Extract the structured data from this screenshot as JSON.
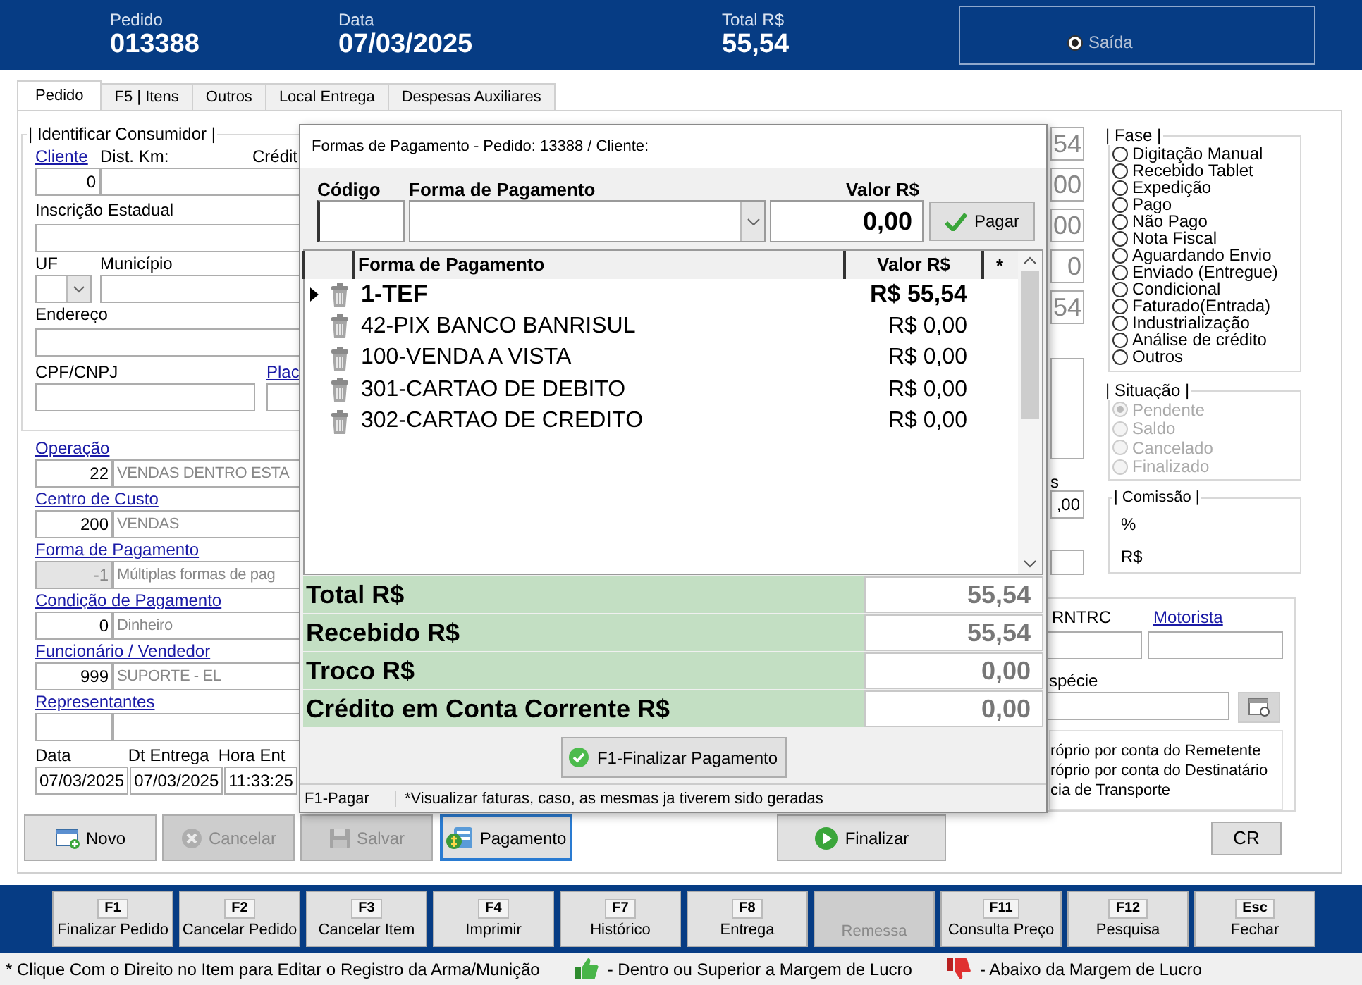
{
  "header": {
    "fields": [
      {
        "label": "Pedido",
        "value": "013388"
      },
      {
        "label": "Data",
        "value": "07/03/2025"
      },
      {
        "label": "Total R$",
        "value": "55,54"
      }
    ],
    "radio": {
      "label": "Saída",
      "selected": true
    }
  },
  "tabs": [
    {
      "label": "Pedido",
      "selected": true
    },
    {
      "label": "F5 | Itens",
      "selected": false
    },
    {
      "label": "Outros",
      "selected": false
    },
    {
      "label": "Local Entrega",
      "selected": false
    },
    {
      "label": "Despesas Auxiliares",
      "selected": false
    }
  ],
  "consumer": {
    "title": "| Identificar Consumidor |",
    "client_link": "Cliente",
    "distance_label": "Dist. Km:",
    "credit_label": "Crédit",
    "client_code": "0",
    "state_registration_label": "Inscrição Estadual",
    "uf_label": "UF",
    "city_label": "Município",
    "address_label": "Endereço",
    "document_label": "CPF/CNPJ",
    "plate_link": "Plac"
  },
  "lookups": [
    {
      "label": "Operação",
      "code": "22",
      "description": "VENDAS DENTRO ESTA",
      "disabled": false
    },
    {
      "label": "Centro de Custo",
      "code": "200",
      "description": "VENDAS",
      "disabled": false
    },
    {
      "label": "Forma de Pagamento",
      "code": "-1",
      "description": "Múltiplas formas de pag",
      "disabled": true
    },
    {
      "label": "Condição de Pagamento",
      "code": "0",
      "description": "Dinheiro",
      "disabled": false
    },
    {
      "label": "Funcionário / Vendedor",
      "code": "999",
      "description": "SUPORTE - EL",
      "disabled": false
    },
    {
      "label": "Representantes",
      "disabled": false
    }
  ],
  "dates": [
    {
      "label": "Data",
      "value": "07/03/2025"
    },
    {
      "label": "Dt Entrega",
      "value": "07/03/2025"
    },
    {
      "label": "Hora Ent",
      "value": "11:33:25"
    }
  ],
  "totals_strip": {
    "values": [
      "54",
      "00",
      "00",
      "0",
      "54"
    ],
    "label": "s",
    "value": ",00"
  },
  "phase": {
    "title": "| Fase |",
    "options": [
      {
        "label": "Digitação Manual",
        "selected": false
      },
      {
        "label": "Recebido Tablet",
        "selected": false
      },
      {
        "label": "Expedição",
        "selected": false
      },
      {
        "label": "Pago",
        "selected": false
      },
      {
        "label": "Não Pago",
        "selected": false
      },
      {
        "label": "Nota Fiscal",
        "selected": false
      },
      {
        "label": "Aguardando Envio",
        "selected": false
      },
      {
        "label": "Enviado (Entregue)",
        "selected": false
      },
      {
        "label": "Condicional",
        "selected": false
      },
      {
        "label": "Faturado(Entrada)",
        "selected": false
      },
      {
        "label": "Industrialização",
        "selected": false
      },
      {
        "label": "Análise de crédito",
        "selected": false
      },
      {
        "label": "Outros",
        "selected": false
      }
    ]
  },
  "situation": {
    "title": "| Situação |",
    "options": [
      {
        "label": "Pendente",
        "selected": true,
        "disabled": true
      },
      {
        "label": "Saldo",
        "selected": false,
        "disabled": true
      },
      {
        "label": "Cancelado",
        "selected": false,
        "disabled": true
      },
      {
        "label": "Finalizado",
        "selected": false,
        "disabled": true
      }
    ]
  },
  "commission": {
    "title": "| Comissão |",
    "percent_label": "%",
    "value_label": "R$"
  },
  "transport": {
    "rntrc_label": "RNTRC",
    "driver_link": "Motorista",
    "species_label": "spécie",
    "freight_options": [
      "róprio por conta do Remetente",
      "róprio por conta do Destinatário",
      "cia de Transporte"
    ]
  },
  "actions": [
    {
      "label": "Novo",
      "kind": "new",
      "disabled": false,
      "focused": false
    },
    {
      "label": "Cancelar",
      "kind": "cancel",
      "disabled": true,
      "focused": false
    },
    {
      "label": "Salvar",
      "kind": "save",
      "disabled": true,
      "focused": false
    },
    {
      "label": "Pagamento",
      "kind": "payment",
      "disabled": false,
      "focused": true
    },
    {
      "label": "Finalizar",
      "kind": "finish",
      "disabled": false,
      "focused": false
    },
    {
      "label": "CR",
      "kind": "plain",
      "disabled": false,
      "focused": false
    }
  ],
  "dialog": {
    "title": "Formas de Pagamento - Pedido: 13388 / Cliente:",
    "code_label": "Código",
    "method_label": "Forma de Pagamento",
    "amount_label": "Valor R$",
    "amount_value": "0,00",
    "pay_button": "Pagar",
    "columns": [
      "Forma de Pagamento",
      "Valor R$",
      "*"
    ],
    "rows": [
      {
        "method": "1-TEF",
        "amount": "R$ 55,54",
        "selected": true
      },
      {
        "method": "42-PIX BANCO BANRISUL",
        "amount": "R$ 0,00",
        "selected": false
      },
      {
        "method": "100-VENDA A VISTA",
        "amount": "R$ 0,00",
        "selected": false
      },
      {
        "method": "301-CARTAO DE DEBITO",
        "amount": "R$ 0,00",
        "selected": false
      },
      {
        "method": "302-CARTAO DE CREDITO",
        "amount": "R$ 0,00",
        "selected": false
      }
    ],
    "totals": [
      {
        "label": "Total R$",
        "value": "55,54"
      },
      {
        "label": "Recebido R$",
        "value": "55,54"
      },
      {
        "label": "Troco R$",
        "value": "0,00"
      },
      {
        "label": "Crédito em Conta Corrente R$",
        "value": "0,00"
      }
    ],
    "finish_button": "F1-Finalizar Pagamento",
    "status": [
      "F1-Pagar",
      "*Visualizar faturas, caso, as mesmas ja tiverem sido geradas"
    ]
  },
  "function_keys": [
    {
      "key": "F1",
      "label": "Finalizar Pedido",
      "disabled": false
    },
    {
      "key": "F2",
      "label": "Cancelar Pedido",
      "disabled": false
    },
    {
      "key": "F3",
      "label": "Cancelar Item",
      "disabled": false
    },
    {
      "key": "F4",
      "label": "Imprimir",
      "disabled": false
    },
    {
      "key": "F7",
      "label": "Histórico",
      "disabled": false
    },
    {
      "key": "F8",
      "label": "Entrega",
      "disabled": false
    },
    {
      "label": "Remessa",
      "disabled": true
    },
    {
      "key": "F11",
      "label": "Consulta Preço",
      "disabled": false
    },
    {
      "key": "F12",
      "label": "Pesquisa",
      "disabled": false
    },
    {
      "key": "Esc",
      "label": "Fechar",
      "disabled": false
    }
  ],
  "status_bar": {
    "hint": "* Clique Com o Direito no Item para Editar o Registro da Arma/Munição",
    "legend": [
      {
        "kind": "up",
        "label": "- Dentro ou Superior a Margem de Lucro"
      },
      {
        "kind": "down",
        "label": "- Abaixo da Margem de Lucro"
      }
    ]
  }
}
